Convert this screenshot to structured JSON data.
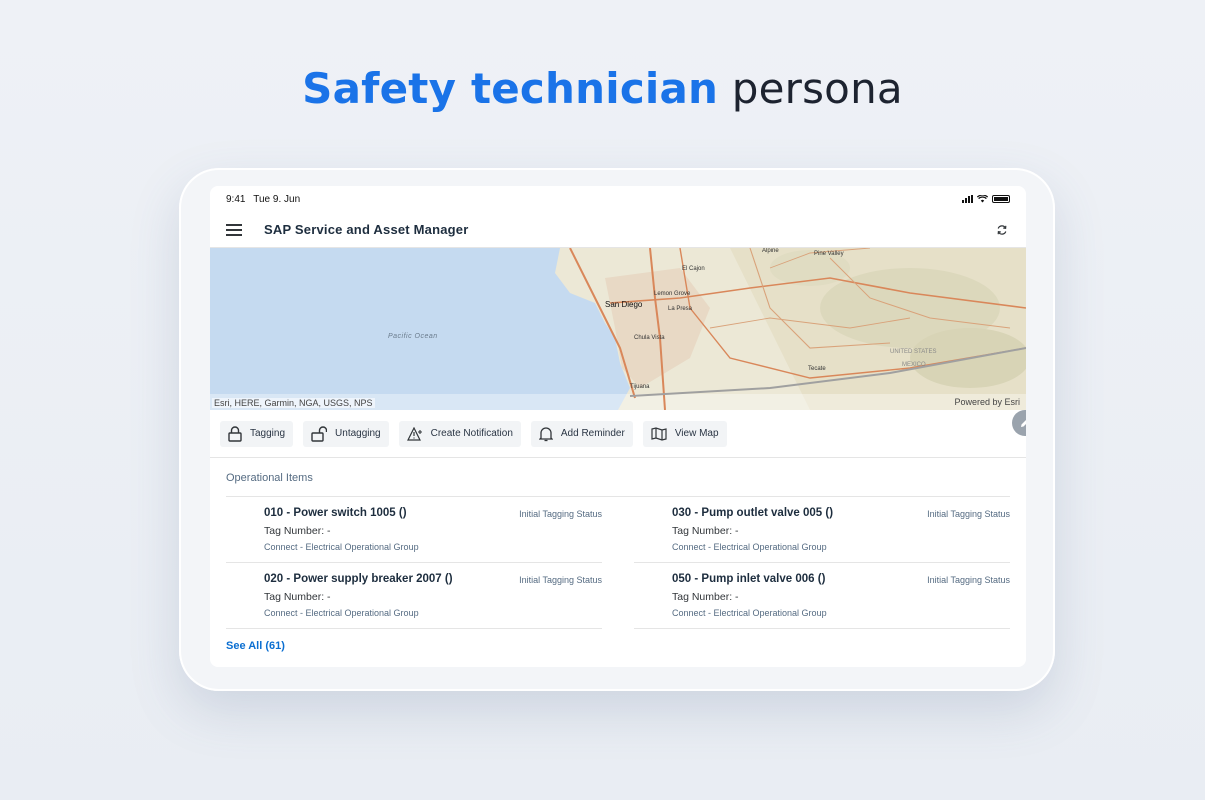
{
  "headline": {
    "accent": "Safety technician",
    "rest": "persona"
  },
  "status_bar": {
    "time": "9:41",
    "date": "Tue 9. Jun"
  },
  "app": {
    "title": "SAP Service and Asset Manager"
  },
  "map": {
    "credit": "Esri, HERE, Garmin, NGA, USGS, NPS",
    "powered_by": "Powered by Esri",
    "labels": {
      "ocean": "Pacific Ocean",
      "san_diego": "San Diego",
      "chula_vista": "Chula Vista",
      "tijuana": "Tijuana",
      "el_cajon": "El Cajon",
      "lemon_grove": "Lemon Grove",
      "la_presa": "La Presa",
      "alpine": "Alpine",
      "pine_valley": "Pine Valley",
      "tecate": "Tecate",
      "united_states": "UNITED STATES",
      "mexico": "MEXICO"
    }
  },
  "actions": [
    {
      "label": "Tagging",
      "icon": "lock-icon"
    },
    {
      "label": "Untagging",
      "icon": "unlock-icon"
    },
    {
      "label": "Create Notification",
      "icon": "warning-icon"
    },
    {
      "label": "Add Reminder",
      "icon": "bell-icon"
    },
    {
      "label": "View Map",
      "icon": "map-icon"
    }
  ],
  "operational_items": {
    "title": "Operational Items",
    "items": [
      {
        "title": "010 - Power switch 1005 ()",
        "status": "Initial Tagging Status",
        "tag": "Tag Number: -",
        "group": "Connect - Electrical Operational Group"
      },
      {
        "title": "030 - Pump outlet valve 005 ()",
        "status": "Initial Tagging Status",
        "tag": "Tag Number: -",
        "group": "Connect - Electrical Operational Group"
      },
      {
        "title": "020 - Power supply breaker 2007 ()",
        "status": "Initial Tagging Status",
        "tag": "Tag Number: -",
        "group": "Connect - Electrical Operational Group"
      },
      {
        "title": "050 - Pump inlet valve 006 ()",
        "status": "Initial Tagging Status",
        "tag": "Tag Number: -",
        "group": "Connect - Electrical Operational Group"
      }
    ],
    "see_all": "See All (61)"
  },
  "colors": {
    "accent": "#1a73e8",
    "link": "#0a6ed1",
    "ocean": "#c5daf0",
    "land": "#ece8d6"
  }
}
